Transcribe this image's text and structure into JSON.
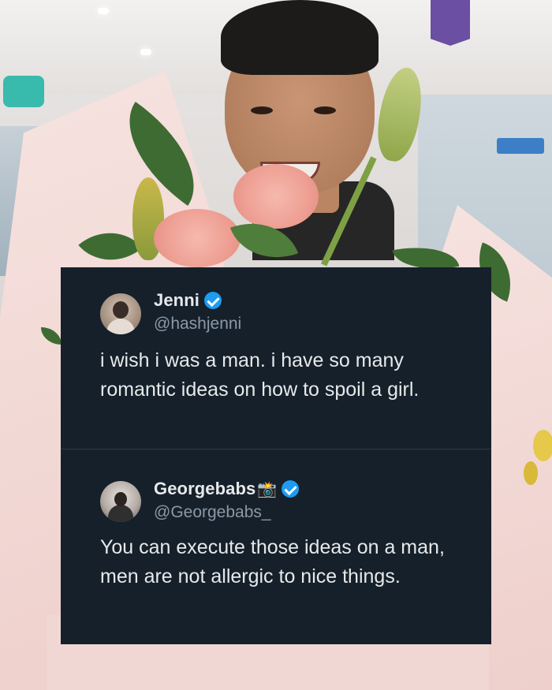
{
  "tweets": [
    {
      "display_name": "Jenni",
      "handle": "@hashjenni",
      "verified": true,
      "text": "i wish i was a man. i have so many romantic ideas on how to spoil a girl."
    },
    {
      "display_name": "Georgebabs",
      "name_emoji": "📸",
      "handle": "@Georgebabs_",
      "verified": true,
      "text": "You can execute those ideas on a man, men are not allergic to nice things."
    }
  ],
  "colors": {
    "card_background": "#15202b",
    "primary_text": "#e7e9ea",
    "secondary_text": "#8b98a5",
    "verified_badge": "#1d9bf0"
  },
  "icons": [
    "verified-badge-icon",
    "camera-flash-icon"
  ]
}
